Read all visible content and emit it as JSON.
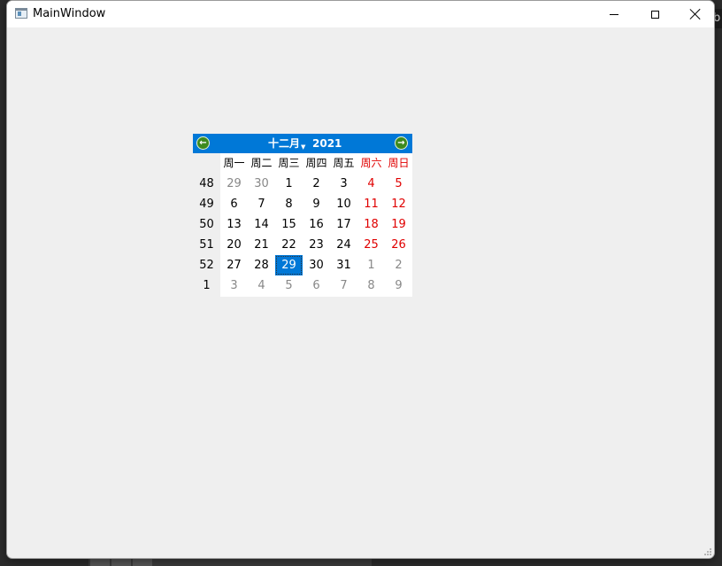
{
  "window": {
    "title": "MainWindow",
    "controls": {
      "minimize": "minimize",
      "maximize": "maximize",
      "close": "close"
    }
  },
  "background": {
    "edge_text": "b"
  },
  "calendar": {
    "month": "十二月",
    "year": "2021",
    "nav": {
      "prev": "previous-month",
      "next": "next-month"
    },
    "weekday_headers": [
      "周一",
      "周二",
      "周三",
      "周四",
      "周五",
      "周六",
      "周日"
    ],
    "weeks": [
      {
        "number": "48",
        "days": [
          "29",
          "30",
          "1",
          "2",
          "3",
          "4",
          "5"
        ]
      },
      {
        "number": "49",
        "days": [
          "6",
          "7",
          "8",
          "9",
          "10",
          "11",
          "12"
        ]
      },
      {
        "number": "50",
        "days": [
          "13",
          "14",
          "15",
          "16",
          "17",
          "18",
          "19"
        ]
      },
      {
        "number": "51",
        "days": [
          "20",
          "21",
          "22",
          "23",
          "24",
          "25",
          "26"
        ]
      },
      {
        "number": "52",
        "days": [
          "27",
          "28",
          "29",
          "30",
          "31",
          "1",
          "2"
        ]
      },
      {
        "number": "1",
        "days": [
          "3",
          "4",
          "5",
          "6",
          "7",
          "8",
          "9"
        ]
      }
    ],
    "selected_day": "29",
    "colors": {
      "header": "#0078d7",
      "weekend": "#e00000",
      "other_month": "#888888",
      "selected": "#0078d7"
    }
  }
}
